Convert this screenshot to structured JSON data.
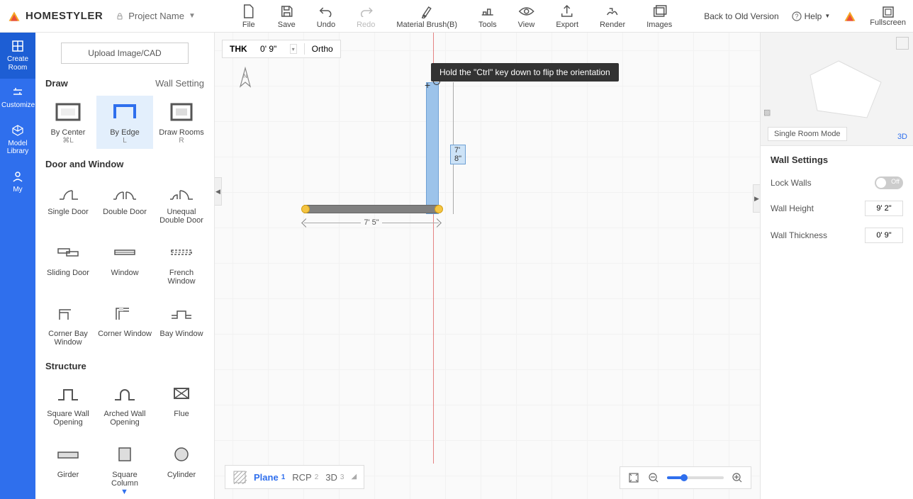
{
  "app": {
    "name": "HOMESTYLER",
    "project": "Project Name"
  },
  "topTools": {
    "file": "File",
    "save": "Save",
    "undo": "Undo",
    "redo": "Redo",
    "materialBrush": "Material Brush(B)",
    "tools": "Tools",
    "view": "View",
    "export": "Export",
    "render": "Render",
    "images": "Images"
  },
  "right": {
    "back": "Back to Old Version",
    "help": "Help",
    "fullscreen": "Fullscreen"
  },
  "rail": {
    "createRoom": "Create Room",
    "customize": "Customize",
    "modelLibrary": "Model Library",
    "my": "My"
  },
  "sidebar": {
    "uploadLabel": "Upload Image/CAD",
    "section1": "Draw",
    "wallSetting": "Wall Setting",
    "draw": {
      "byCenter": "By Center",
      "byCenterKey": "⌘L",
      "byEdge": "By Edge",
      "byEdgeKey": "L",
      "drawRooms": "Draw Rooms",
      "drawRoomsKey": "R"
    },
    "doorWindow": "Door and Window",
    "dw": {
      "singleDoor": "Single Door",
      "doubleDoor": "Double Door",
      "unequalDoubleDoor": "Unequal Double Door",
      "slidingDoor": "Sliding Door",
      "window": "Window",
      "frenchWindow": "French Window",
      "cornerBayWindow": "Corner Bay Window",
      "cornerWindow": "Corner Window",
      "bayWindow": "Bay Window"
    },
    "structure": "Structure",
    "st": {
      "squareWallOpening": "Square Wall Opening",
      "archedWallOpening": "Arched Wall Opening",
      "flue": "Flue",
      "girder": "Girder",
      "squareColumn": "Square Column",
      "cylinder": "Cylinder"
    }
  },
  "thk": {
    "label": "THK",
    "value": "0' 9\"",
    "ortho": "Ortho"
  },
  "hint": "Hold the \"Ctrl\" key down to flip the orientation",
  "dims": {
    "h": "7' 5\"",
    "v": "7' 8\""
  },
  "viewbar": {
    "plane": "Plane",
    "planeNum": "1",
    "rcp": "RCP",
    "rcpNum": "2",
    "threeD": "3D",
    "threeDNum": "3"
  },
  "rightPanel": {
    "mode": "Single Room Mode",
    "threeD": "3D",
    "title": "Wall Settings",
    "lockWalls": "Lock Walls",
    "lockState": "Off",
    "wallHeight": "Wall Height",
    "wallHeightVal": "9' 2\"",
    "wallThickness": "Wall Thickness",
    "wallThicknessVal": "0' 9\""
  }
}
